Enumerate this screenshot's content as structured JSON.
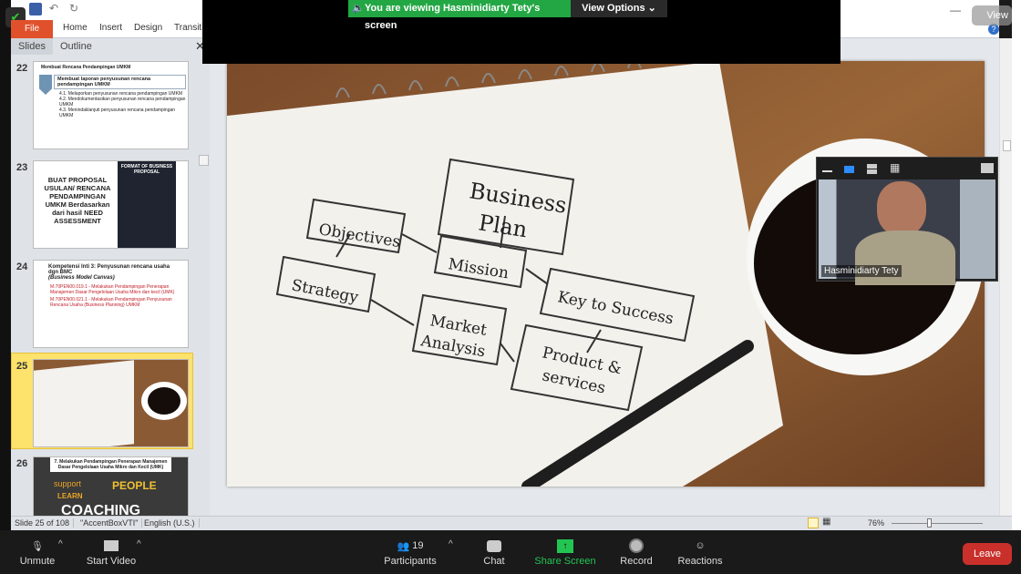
{
  "zoom_overlay": {
    "banner": "You are viewing Hasminidiarty Tety's screen",
    "view_options": "View Options",
    "view_button": "View"
  },
  "ribbon": {
    "tabs": [
      "File",
      "Home",
      "Insert",
      "Design",
      "Transitio"
    ]
  },
  "panel": {
    "tabs": [
      "Slides",
      "Outline"
    ]
  },
  "slides": [
    {
      "num": "22",
      "title": "Membuat Rencana Pendampingan UMKM",
      "box": "Membuat laporan penyusunan rencana pendampingan UMKM",
      "items": [
        "4.1. Melaporkan penyusunan rencana pendampingan UMKM",
        "4.2. Mendokumentasikan penyusunan rencana pendampingan UMKM",
        "4.3. Menindaklanjuti penyusunan rencana pendampingan UMKM"
      ]
    },
    {
      "num": "23",
      "text": "BUAT PROPOSAL USULAN/ RENCANA PENDAMPINGAN UMKM Berdasarkan dari hasil NEED ASSESSMENT",
      "side": "FORMAT OF BUSINESS PROPOSAL"
    },
    {
      "num": "24",
      "title": "Kompetensi Inti 3: Penyusunan rencana usaha dgn BMC",
      "subtitle": "(Business Model Canvas)",
      "items": [
        "M.70PEN00.019.1 - Melakukan Pendampingan Penerapan Manajemen Dasar Pengelolaan Usaha Mikro dan kecil (UMK)",
        "M.70PEN00.021.1 - Melakukan Pendampingan Penyusunan Rencana Usaha (Business Planning) UMKM"
      ]
    },
    {
      "num": "25"
    },
    {
      "num": "26",
      "title": "7. Melakukan Pendampingan Penerapan Manajemen Dasar Pengelolaan Usaha Mikro dan Kecil (UMK)",
      "words": [
        "support",
        "PEOPLE",
        "LEARN",
        "COACHING"
      ]
    }
  ],
  "selected_slide": "25",
  "diagram": {
    "business_plan": [
      "Business",
      "Plan"
    ],
    "objectives": "Objectives",
    "mission": "Mission",
    "strategy": "Strategy",
    "key": "Key to Success",
    "market": [
      "Market",
      "Analysis"
    ],
    "product": [
      "Product &",
      "services"
    ]
  },
  "status": {
    "slide": "Slide 25 of 108",
    "theme": "\"AccentBoxVTI\"",
    "lang": "English (U.S.)",
    "zoom": "76%"
  },
  "video": {
    "name": "Hasminidiarty Tety"
  },
  "toolbar": {
    "unmute": "Unmute",
    "video": "Start Video",
    "participants": "Participants",
    "participants_count": "19",
    "chat": "Chat",
    "share": "Share Screen",
    "record": "Record",
    "reactions": "Reactions",
    "leave": "Leave"
  },
  "colors": {
    "zoom_green": "#23a744",
    "leave_red": "#c9302c",
    "file_tab": "#e0512b",
    "selected_thumb": "#fde26b"
  }
}
